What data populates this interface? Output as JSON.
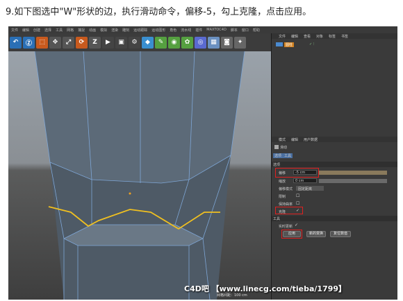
{
  "instruction": "9.如下图选中\"W\"形状的边，执行滑动命令，偏移-5，勾上克隆，点击应用。",
  "menu": [
    "文件",
    "编辑",
    "创建",
    "选择",
    "工具",
    "网格",
    "捕捉",
    "动画",
    "模拟",
    "渲染",
    "雕刻",
    "运动跟踪",
    "运动图形",
    "角色",
    "流水线",
    "插件",
    "MAXTOC4D",
    "脚本",
    "窗口",
    "帮助"
  ],
  "toolbar_icons": [
    "undo-icon",
    "redo-icon",
    "select-icon",
    "move-icon",
    "scale-icon",
    "rotate-icon",
    "z-axis-icon",
    "coord-icon",
    "render-view-icon",
    "render-icon",
    "render-settings-icon",
    "cube-icon",
    "pen-icon",
    "subdivide-icon",
    "array-icon",
    "deformer-icon",
    "scene-icon",
    "camera-icon",
    "light-icon"
  ],
  "obj_manager": {
    "tabs": [
      "文件",
      "编辑",
      "查看",
      "对象",
      "标签",
      "书签"
    ],
    "object_name": "圆柱"
  },
  "attr_manager": {
    "tabs": [
      "模式",
      "编辑",
      "用户数据"
    ],
    "tool_name": "滑动",
    "subtabs": [
      "选项",
      "工具"
    ],
    "section_options": "选项",
    "offset_label": "偏移",
    "offset_value": "-5 cm",
    "scale_label": "缩放",
    "scale_value": "0 cm",
    "offset_mode_label": "偏移模式",
    "offset_mode_value": "固定距离",
    "limit_label": "限制",
    "keep_curvature_label": "保持曲率",
    "clone_label": "克隆",
    "clone_check": "✓",
    "section_tool": "工具",
    "realtime_label": "实时更新",
    "apply_label": "应用",
    "new_transform_label": "新的变换",
    "reset_label": "复位数值"
  },
  "viewport_footer": "网格间距：100 cm",
  "watermark": "C4D吧 【www.linecg.com/tieba/1799】"
}
